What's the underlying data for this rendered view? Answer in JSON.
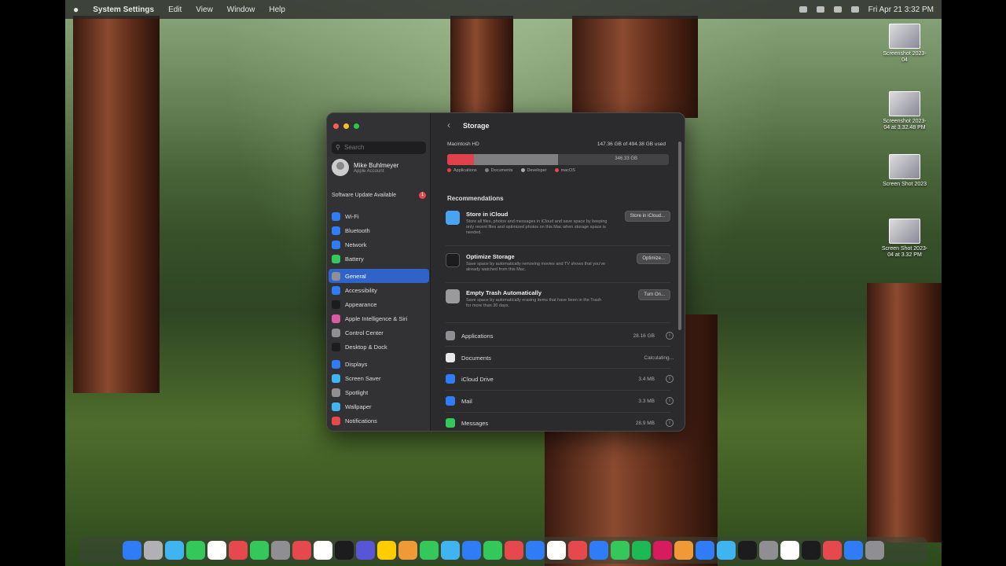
{
  "menubar": {
    "app": "System Settings",
    "items": [
      "Edit",
      "View",
      "Window",
      "Help"
    ],
    "clock": "Fri Apr 21 3:32 PM"
  },
  "desktop_items": [
    {
      "name": "Screenshot 2023-04"
    },
    {
      "name": "Screenshot 2023-04 at 3.32.48 PM"
    },
    {
      "name": "Screen Shot 2023"
    },
    {
      "name": "Screen Shot 2023-04 at 3.32 PM"
    }
  ],
  "sidebar": {
    "search_placeholder": "Search",
    "user_name": "Mike Buhlmeyer",
    "user_sub": "Apple Account",
    "update_label": "Software Update Available",
    "update_count": "1",
    "items": [
      {
        "label": "Wi-Fi",
        "color": "#2f7cf6"
      },
      {
        "label": "Bluetooth",
        "color": "#2f7cf6"
      },
      {
        "label": "Network",
        "color": "#2f7cf6"
      },
      {
        "label": "Battery",
        "color": "#34c759"
      },
      {
        "label": "General",
        "color": "#8e8e93",
        "selected": true
      },
      {
        "label": "Accessibility",
        "color": "#2f7cf6"
      },
      {
        "label": "Appearance",
        "color": "#1c1c1e"
      },
      {
        "label": "Apple Intelligence & Siri",
        "color": "#d85aa3"
      },
      {
        "label": "Control Center",
        "color": "#8e8e93"
      },
      {
        "label": "Desktop & Dock",
        "color": "#1c1c1e"
      },
      {
        "label": "Displays",
        "color": "#2f7cf6"
      },
      {
        "label": "Screen Saver",
        "color": "#3fb4f0"
      },
      {
        "label": "Spotlight",
        "color": "#8e8e93"
      },
      {
        "label": "Wallpaper",
        "color": "#3fb4f0"
      },
      {
        "label": "Notifications",
        "color": "#e5484d"
      }
    ]
  },
  "content": {
    "title": "Storage",
    "back": "‹",
    "disk_name": "Macintosh HD",
    "disk_usage": "147.36 GB of 494.38 GB used",
    "free_label": "346.33 GB",
    "usage_fraction": 0.5,
    "legend": [
      "Applications",
      "Documents",
      "Developer",
      "macOS"
    ],
    "recommendations_title": "Recommendations",
    "recommendations": [
      {
        "title": "Store in iCloud",
        "desc": "Store all files, photos and messages in iCloud and save space by keeping only recent files and optimized photos on this Mac when storage space is needed.",
        "button": "Store in iCloud...",
        "color": "#4aa3f0"
      },
      {
        "title": "Optimize Storage",
        "desc": "Save space by automatically removing movies and TV shows that you've already watched from this Mac.",
        "button": "Optimize...",
        "color": "#1c1c1e"
      },
      {
        "title": "Empty Trash Automatically",
        "desc": "Save space by automatically erasing items that have been in the Trash for more than 30 days.",
        "button": "Turn On...",
        "color": "#9a9a9d"
      }
    ],
    "categories": [
      {
        "name": "Applications",
        "size": "28.16 GB",
        "color": "#8e8e93"
      },
      {
        "name": "Documents",
        "size": "Calculating...",
        "color": "#e8e8e8"
      },
      {
        "name": "iCloud Drive",
        "size": "3.4 MB",
        "color": "#2f7cf6"
      },
      {
        "name": "Mail",
        "size": "3.3 MB",
        "color": "#2f7cf6"
      },
      {
        "name": "Messages",
        "size": "28.9 MB",
        "color": "#34c759"
      }
    ]
  },
  "dock_colors": [
    "#2f7cf6",
    "#b0b0b5",
    "#3fb4f0",
    "#34c759",
    "#ffffff",
    "#e5484d",
    "#34c759",
    "#8e8e93",
    "#e5484d",
    "#ffffff",
    "#1c1c1e",
    "#5856d6",
    "#ffcc00",
    "#f09a37",
    "#34c759",
    "#3fb4f0",
    "#2f7cf6",
    "#34c759",
    "#e5484d",
    "#2f7cf6",
    "#ffffff",
    "#e5484d",
    "#2f7cf6",
    "#34c759",
    "#1db954",
    "#d81b60",
    "#f09a37",
    "#2f7cf6",
    "#3fb4f0",
    "#1c1c1e",
    "#8e8e93",
    "#ffffff",
    "#1c1c1e",
    "#e5484d",
    "#2f7cf6",
    "#8e8e93"
  ]
}
